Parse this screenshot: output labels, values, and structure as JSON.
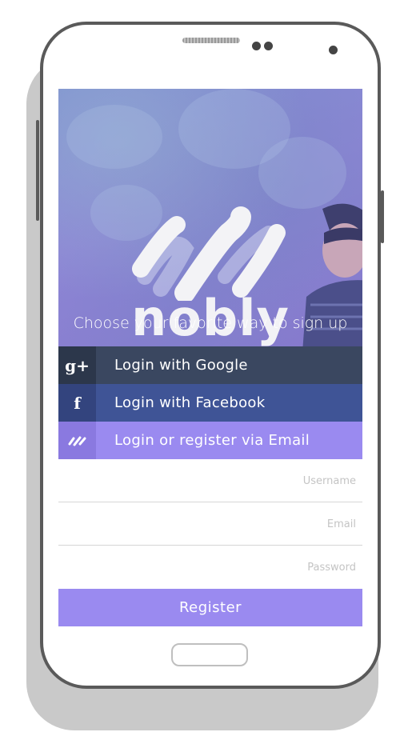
{
  "brand": {
    "name": "nobly",
    "tagline": "Choose your favorite way to sign up",
    "accent": "#9a8af0"
  },
  "login_options": [
    {
      "label": "Login with Google",
      "icon": "google-plus-icon",
      "color": "#3a4760"
    },
    {
      "label": "Login with Facebook",
      "icon": "facebook-icon",
      "color": "#3f5496"
    },
    {
      "label": "Login or register via Email",
      "icon": "nobly-email-icon",
      "color": "#9a8af0"
    }
  ],
  "form": {
    "username_placeholder": "Username",
    "email_placeholder": "Email",
    "password_placeholder": "Password",
    "register_label": "Register"
  },
  "icons": {
    "google": "g+",
    "facebook": "f"
  }
}
